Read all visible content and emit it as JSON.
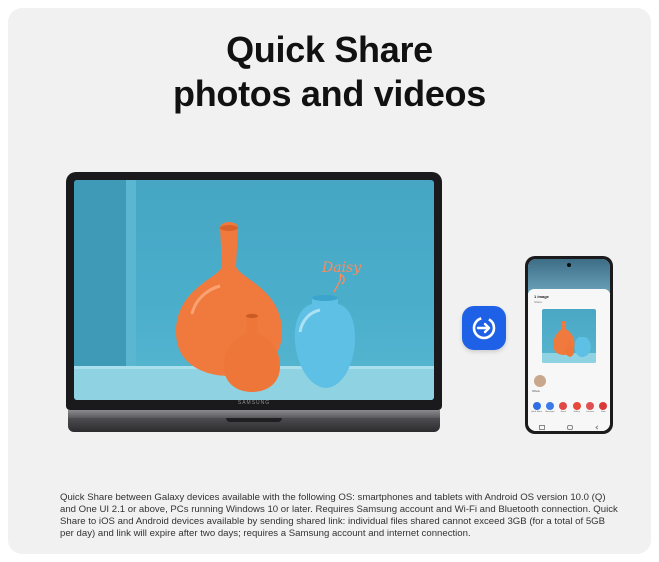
{
  "headline": {
    "line1": "Quick Share",
    "line2": "photos and videos"
  },
  "laptop": {
    "brand": "SAMSUNG",
    "wallpaper_label": "Daisy"
  },
  "share_icon": {
    "icon": "quick-share-icon",
    "color": "#1f61e6"
  },
  "phone": {
    "sheet_title": "1 image",
    "sheet_subtitle": "Share",
    "contact_name": "Olivia",
    "apps": [
      {
        "label": "Quick Share",
        "color": "#2f6fe6"
      },
      {
        "label": "Messages",
        "color": "#3a7be8"
      },
      {
        "label": "Email",
        "color": "#e04848"
      },
      {
        "label": "Gallery",
        "color": "#e8483a"
      },
      {
        "label": "Contacts",
        "color": "#e05050"
      },
      {
        "label": "More",
        "color": "#d83a3a"
      }
    ]
  },
  "disclaimer": "Quick Share between Galaxy devices available with the following OS: smartphones and tablets with Android OS version 10.0 (Q) and One UI 2.1 or above, PCs running Windows 10 or later. Requires Samsung account and Wi-Fi and Bluetooth connection. Quick Share to iOS and Android devices available by sending shared link: individual files shared cannot exceed 3GB (for a total of 5GB per day) and link will expire after two days; requires a Samsung account and internet connection."
}
